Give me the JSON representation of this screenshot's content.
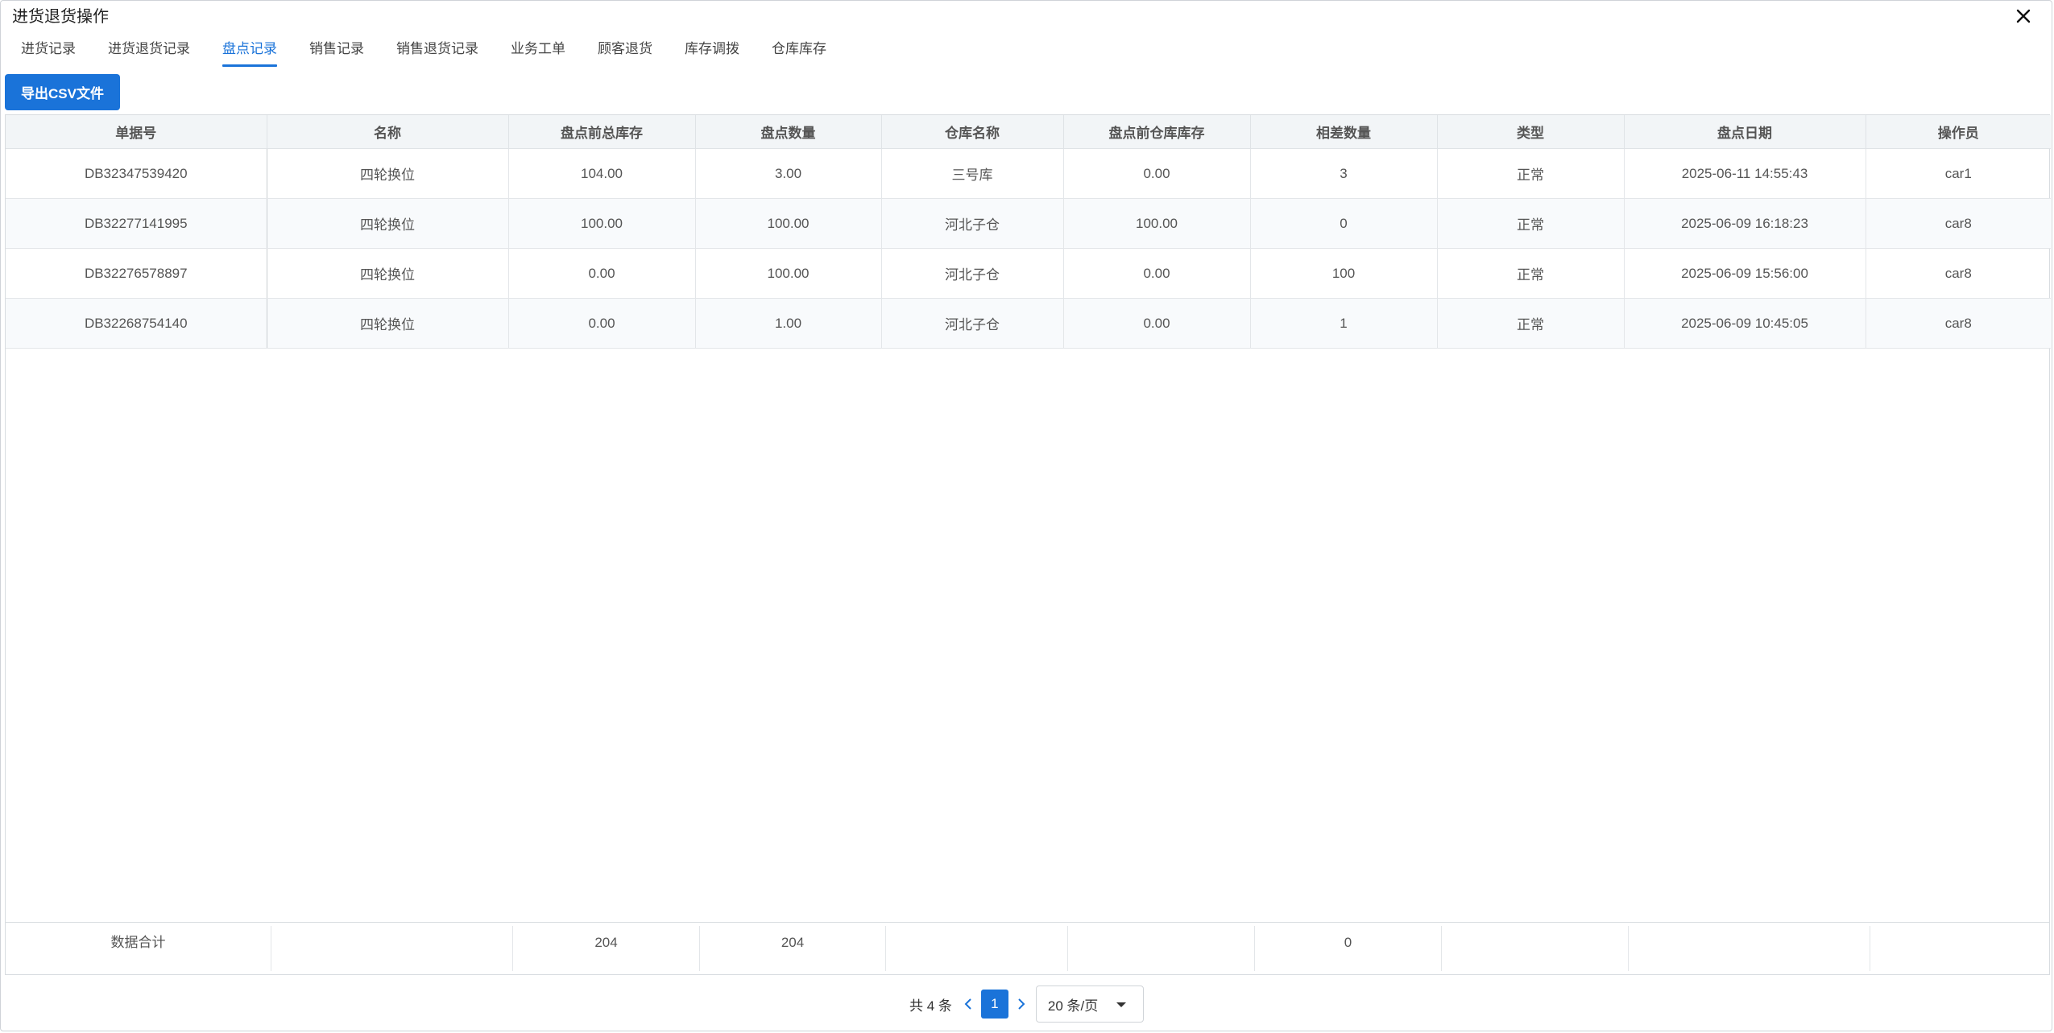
{
  "dialog": {
    "title": "进货退货操作"
  },
  "tabs": [
    {
      "label": "进货记录",
      "active": false
    },
    {
      "label": "进货退货记录",
      "active": false
    },
    {
      "label": "盘点记录",
      "active": true
    },
    {
      "label": "销售记录",
      "active": false
    },
    {
      "label": "销售退货记录",
      "active": false
    },
    {
      "label": "业务工单",
      "active": false
    },
    {
      "label": "顾客退货",
      "active": false
    },
    {
      "label": "库存调拨",
      "active": false
    },
    {
      "label": "仓库库存",
      "active": false
    }
  ],
  "toolbar": {
    "export_label": "导出CSV文件"
  },
  "table": {
    "columns": [
      "单据号",
      "名称",
      "盘点前总库存",
      "盘点数量",
      "仓库名称",
      "盘点前仓库库存",
      "相差数量",
      "类型",
      "盘点日期",
      "操作员"
    ],
    "rows": [
      [
        "DB32347539420",
        "四轮换位",
        "104.00",
        "3.00",
        "三号库",
        "0.00",
        "3",
        "正常",
        "2025-06-11 14:55:43",
        "car1"
      ],
      [
        "DB32277141995",
        "四轮换位",
        "100.00",
        "100.00",
        "河北子仓",
        "100.00",
        "0",
        "正常",
        "2025-06-09 16:18:23",
        "car8"
      ],
      [
        "DB32276578897",
        "四轮换位",
        "0.00",
        "100.00",
        "河北子仓",
        "0.00",
        "100",
        "正常",
        "2025-06-09 15:56:00",
        "car8"
      ],
      [
        "DB32268754140",
        "四轮换位",
        "0.00",
        "1.00",
        "河北子仓",
        "0.00",
        "1",
        "正常",
        "2025-06-09 10:45:05",
        "car8"
      ]
    ],
    "summary": [
      "数据合计",
      "",
      "204",
      "204",
      "",
      "",
      "0",
      "",
      "",
      ""
    ]
  },
  "pagination": {
    "total_text": "共 4 条",
    "current_page": "1",
    "page_size": "20 条/页"
  },
  "colors": {
    "accent": "#1a73d9"
  },
  "icons": {
    "close": "close-icon",
    "prev": "chevron-left-icon",
    "next": "chevron-right-icon",
    "dropdown": "caret-down-icon"
  }
}
